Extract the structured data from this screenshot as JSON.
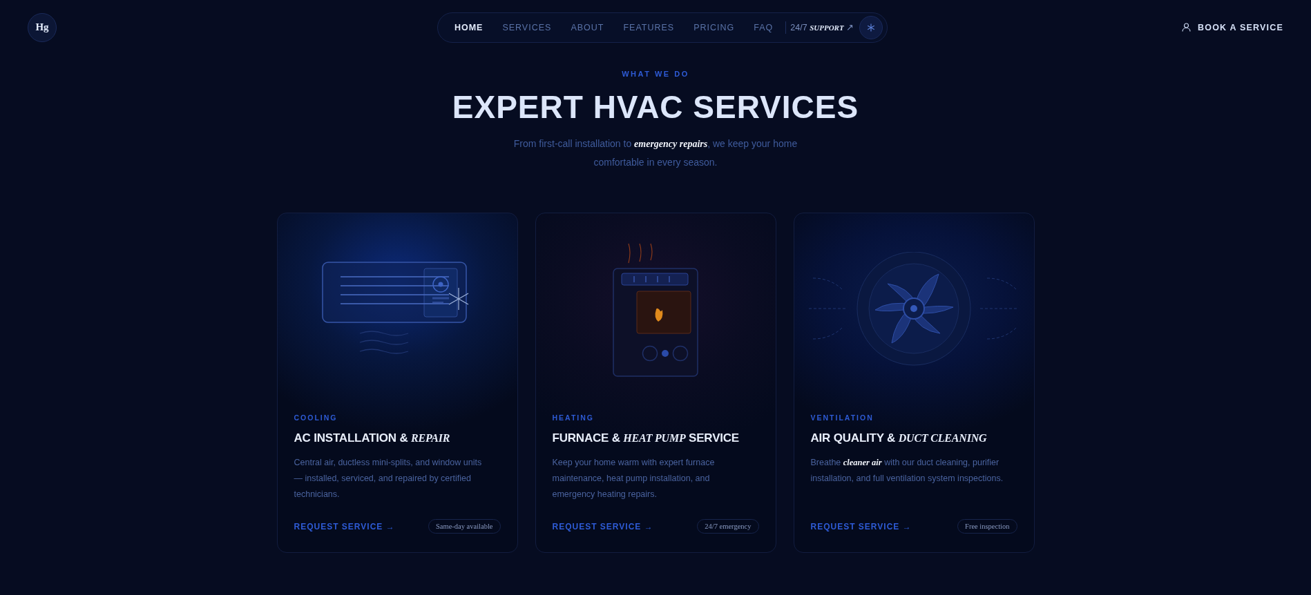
{
  "logo": "Hg",
  "nav": [
    {
      "label": "HOME",
      "selected": true
    },
    {
      "label": "SERVICES",
      "selected": false
    },
    {
      "label": "ABOUT",
      "selected": false
    },
    {
      "label": "FEATURES",
      "selected": false
    },
    {
      "label": "PRICING",
      "selected": false
    },
    {
      "label": "FAQ",
      "selected": false
    }
  ],
  "support_link": "24/7 *SUPPORT* ↗",
  "book_button": "BOOK A SERVICE",
  "section": {
    "eyebrow": "WHAT WE DO",
    "title": "EXPERT HVAC SERVICES",
    "subtitle": "From first-call installation to *emergency repairs*, we keep your home comfortable in every season."
  },
  "cards": [
    {
      "kind": "cooling",
      "category": "COOLING",
      "title": "AC INSTALLATION & *REPAIR*",
      "description": "Central air, ductless mini-splits, and window units — installed, serviced, and repaired by certified technicians.",
      "link": "REQUEST SERVICE →",
      "badge": "Same-day available"
    },
    {
      "kind": "heating",
      "category": "HEATING",
      "title": "FURNACE & *HEAT PUMP* SERVICE",
      "description": "Keep your home warm with expert furnace maintenance, heat pump installation, and emergency heating repairs.",
      "link": "REQUEST SERVICE →",
      "badge": "24/7 emergency"
    },
    {
      "kind": "ventilation",
      "category": "VENTILATION",
      "title": "AIR QUALITY & *DUCT CLEANING*",
      "description": "Breathe *cleaner air* with our duct cleaning, purifier installation, and full ventilation system inspections.",
      "link": "REQUEST SERVICE →",
      "badge": "Free inspection"
    }
  ]
}
